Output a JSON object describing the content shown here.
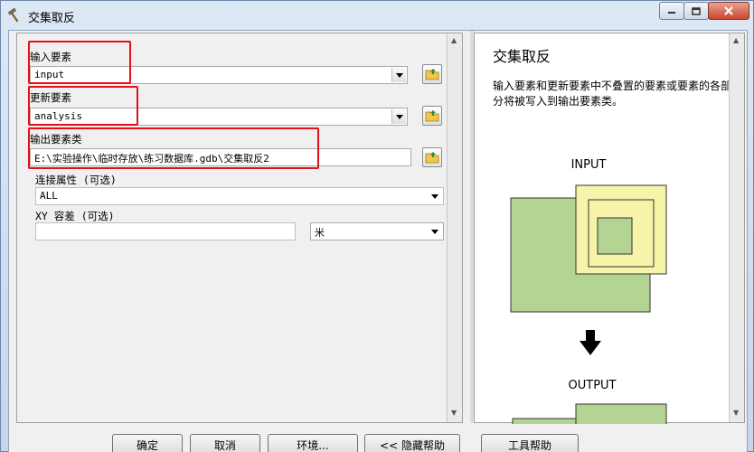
{
  "window": {
    "title": "交集取反",
    "controls": [
      "minimize",
      "maximize",
      "close"
    ]
  },
  "form": {
    "input_features": {
      "label": "输入要素",
      "value": "input"
    },
    "update_features": {
      "label": "更新要素",
      "value": "analysis"
    },
    "output_feature_class": {
      "label": "输出要素类",
      "value": "E:\\实验操作\\临时存放\\练习数据库.gdb\\交集取反2"
    },
    "join_attributes": {
      "label": "连接属性 (可选)",
      "value": "ALL"
    },
    "xy_tolerance": {
      "label": "XY 容差 (可选)",
      "value": "",
      "unit": "米"
    }
  },
  "help": {
    "title": "交集取反",
    "description": "输入要素和更新要素中不叠置的要素或要素的各部分将被写入到输出要素类。",
    "diagram_input_label": "INPUT",
    "diagram_output_label": "OUTPUT"
  },
  "buttons": {
    "ok": "确定",
    "cancel": "取消",
    "environments": "环境...",
    "hide_help": "<< 隐藏帮助",
    "tool_help": "工具帮助"
  },
  "colors": {
    "highlight": "#e3101a",
    "input_polygon": "#b3d493",
    "update_polygon": "#f7f3a9"
  }
}
